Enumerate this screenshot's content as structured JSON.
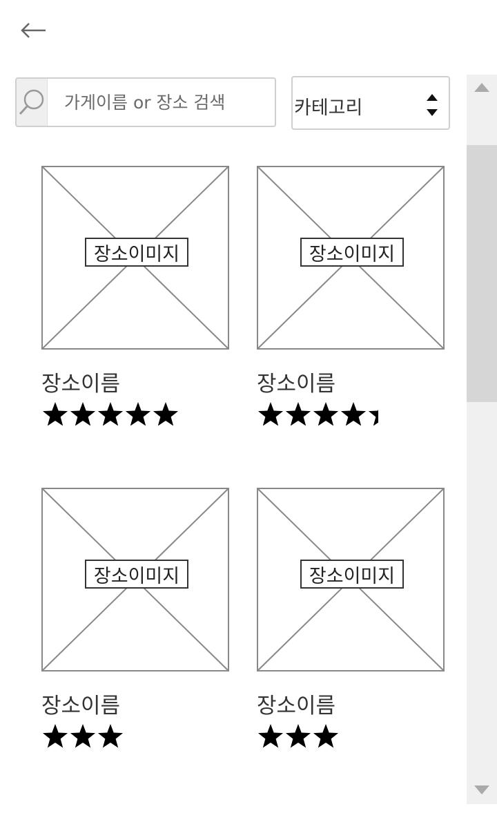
{
  "header": {
    "back_icon": "arrow-left-icon"
  },
  "search": {
    "placeholder": "가게이름 or 장소 검색",
    "value": "",
    "icon": "search-icon"
  },
  "category": {
    "label": "카테고리",
    "icon": "sort-arrows-icon"
  },
  "places": [
    {
      "image_label": "장소이미지",
      "name": "장소이름",
      "rating": 5
    },
    {
      "image_label": "장소이미지",
      "name": "장소이름",
      "rating": 4.4
    },
    {
      "image_label": "장소이미지",
      "name": "장소이름",
      "rating": 3
    },
    {
      "image_label": "장소이미지",
      "name": "장소이름",
      "rating": 3
    }
  ],
  "colors": {
    "star": "#000000",
    "border": "#cfcfcf",
    "placeholder_line": "#888888",
    "scroll_track": "#f0f0f0",
    "scroll_thumb": "#d6d6d6"
  }
}
